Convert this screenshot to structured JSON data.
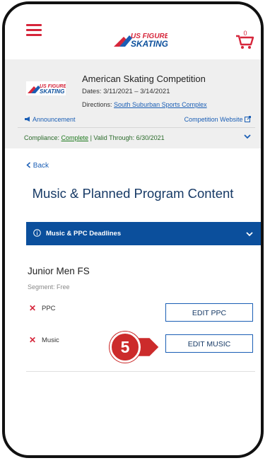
{
  "header": {
    "menu_icon": "hamburger-icon",
    "logo_text": "US FIGURE SKATING",
    "cart_icon": "cart-icon",
    "cart_count": "0"
  },
  "competition": {
    "name": "American Skating Competition",
    "dates": "Dates: 3/11/2021 – 3/14/2021",
    "directions_label": "Directions:",
    "directions_link": "South Suburban Sports Complex",
    "announcement_label": "Announcement",
    "website_label": "Competition Website",
    "compliance_prefix": "Compliance:",
    "compliance_status": "Complete",
    "valid_through": "| Valid Through: 6/30/2021"
  },
  "nav": {
    "back_label": "Back"
  },
  "page": {
    "title": "Music & Planned Program Content"
  },
  "deadlines": {
    "label": "Music & PPC Deadlines"
  },
  "event": {
    "name": "Junior Men FS",
    "segment": "Segment: Free",
    "requirements": [
      {
        "label": "PPC",
        "status_icon": "x-icon",
        "button": "EDIT PPC"
      },
      {
        "label": "Music",
        "status_icon": "x-icon",
        "button": "EDIT MUSIC"
      }
    ]
  },
  "annotation": {
    "step": "5"
  },
  "colors": {
    "brand_red": "#d6263b",
    "brand_blue": "#0b4f9c",
    "link_blue": "#1a5eb5",
    "title_navy": "#173a66"
  }
}
